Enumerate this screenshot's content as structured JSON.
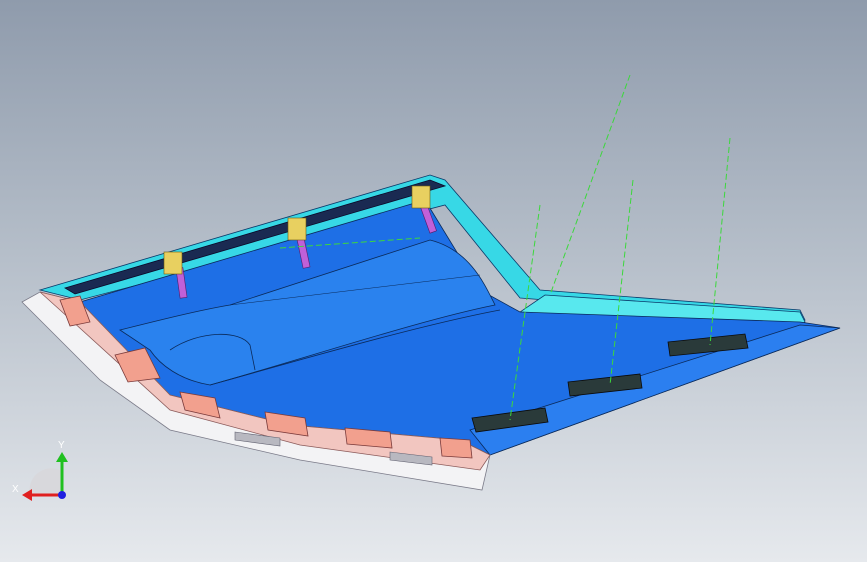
{
  "viewport": {
    "background_top": "#8f9bac",
    "background_bottom": "#e6e9ed"
  },
  "model": {
    "panel_color": "#1e6fe6",
    "panel_light_color": "#2f8cf0",
    "flange_color": "#37d8e6",
    "rail_color": "#1a2a52",
    "clip_color": "#f2a08e",
    "pin_color": "#c060d8",
    "pin_head_color": "#e8d060",
    "latch_color": "#2a3a3a",
    "leader_line_color": "#3cd83c",
    "pins": [
      "pin-1",
      "pin-2",
      "pin-3"
    ],
    "latches": [
      "latch-1",
      "latch-2",
      "latch-3",
      "latch-4"
    ]
  },
  "triad": {
    "x_label": "X",
    "y_label": "Y",
    "x_color": "#e02020",
    "y_color": "#20c020",
    "z_color": "#2020e0"
  }
}
